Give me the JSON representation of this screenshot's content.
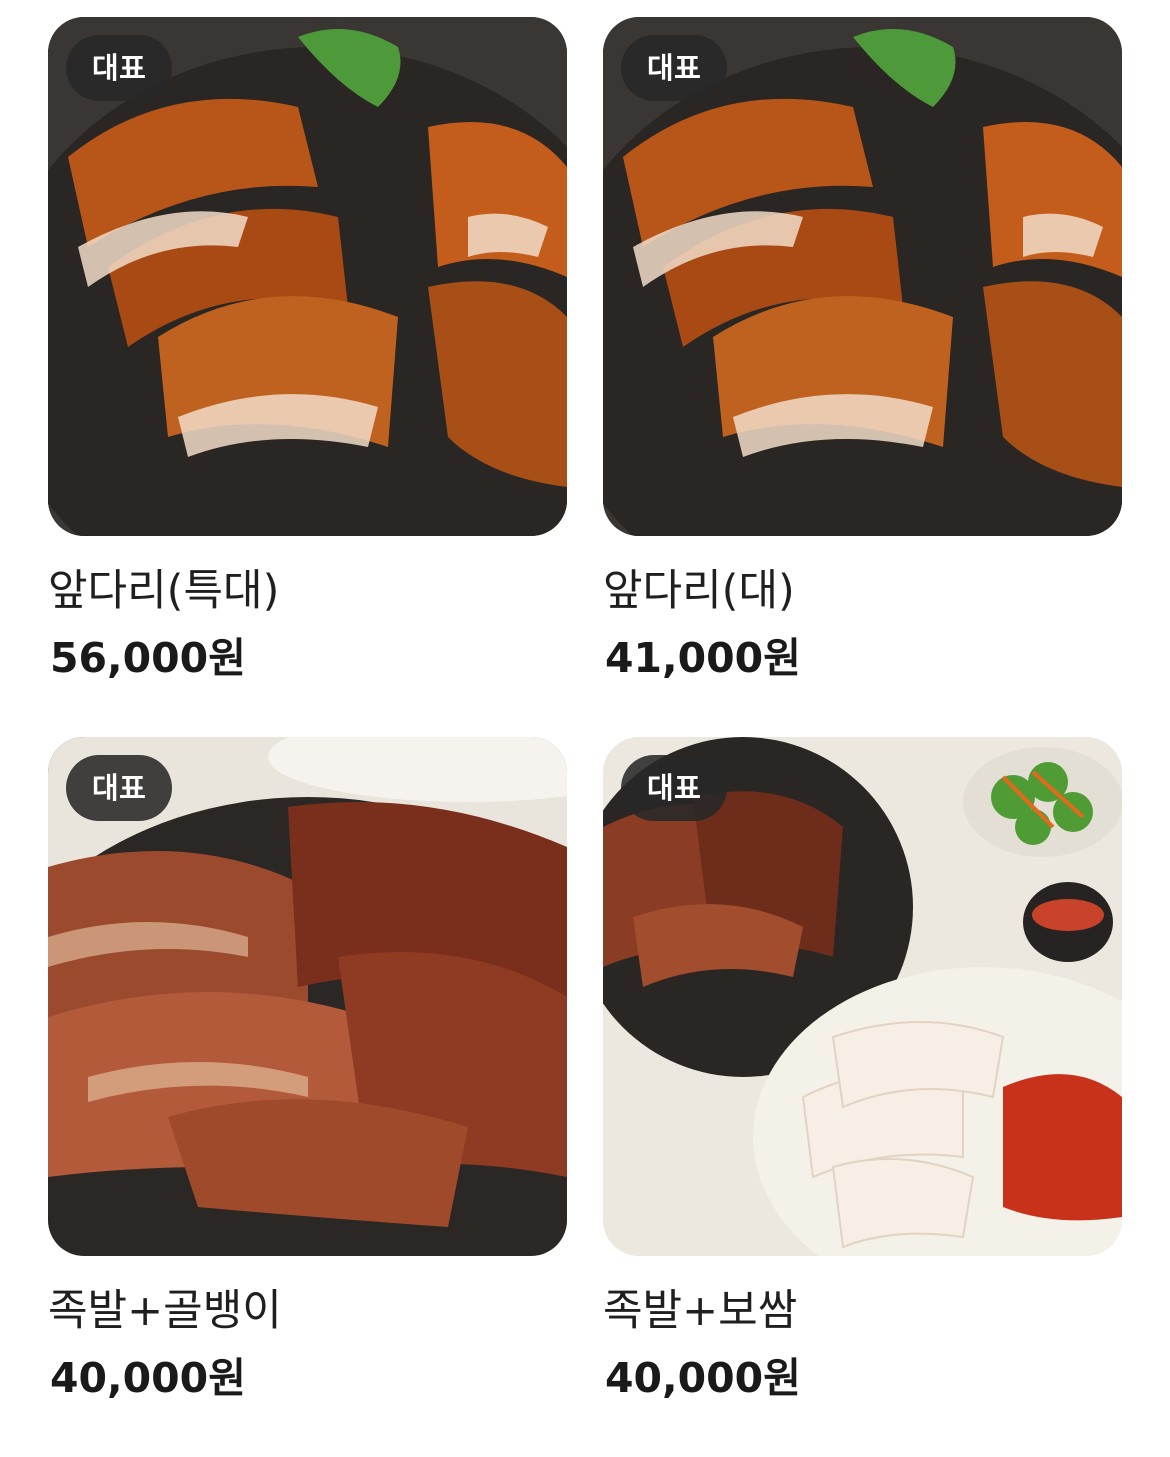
{
  "menu_items": [
    {
      "badge": "대표",
      "name": "앞다리(특대)",
      "price": "56,000원",
      "photo": "jokbal-platter-dark"
    },
    {
      "badge": "대표",
      "name": "앞다리(대)",
      "price": "41,000원",
      "photo": "jokbal-platter-dark"
    },
    {
      "badge": "대표",
      "name": "족발+골뱅이",
      "price": "40,000원",
      "photo": "jokbal-closeup"
    },
    {
      "badge": "대표",
      "name": "족발+보쌈",
      "price": "40,000원",
      "photo": "jokbal-bossam-set"
    }
  ]
}
